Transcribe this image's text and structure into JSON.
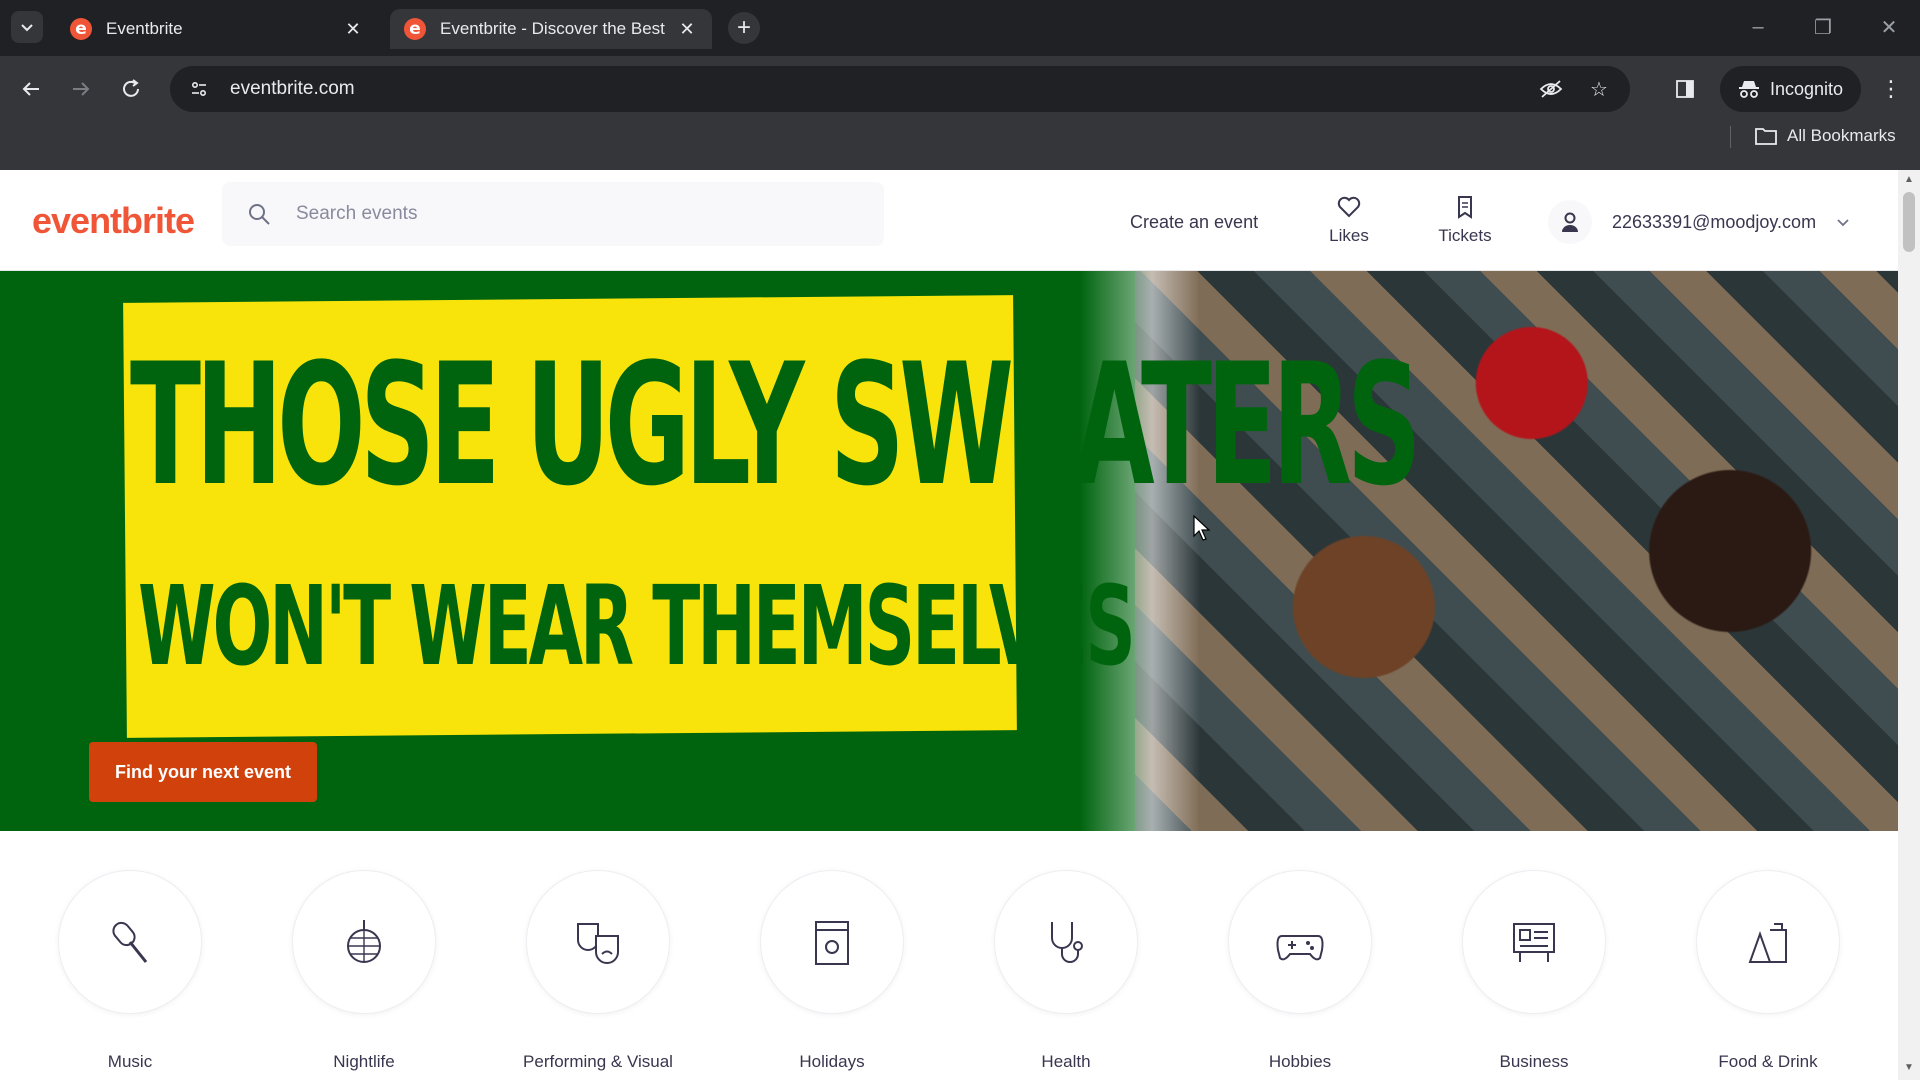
{
  "browser": {
    "tabs": [
      {
        "title": "Eventbrite",
        "favicon": "e",
        "active": false
      },
      {
        "title": "Eventbrite - Discover the Best",
        "favicon": "e",
        "active": true
      }
    ],
    "url": "eventbrite.com",
    "incognito_label": "Incognito",
    "bookmarks_label": "All Bookmarks"
  },
  "header": {
    "logo": "eventbrite",
    "search_placeholder": "Search events",
    "create_event": "Create an event",
    "likes": "Likes",
    "tickets": "Tickets",
    "account_email": "22633391@moodjoy.com"
  },
  "hero": {
    "headline_line1": "THOSE UGLY SWEATERS",
    "headline_line2": "WON'T WEAR THEMSELVES",
    "cta": "Find your next event"
  },
  "categories": [
    {
      "label": "Music",
      "icon": "microphone-icon"
    },
    {
      "label": "Nightlife",
      "icon": "disco-ball-icon"
    },
    {
      "label": "Performing & Visual",
      "icon": "theater-masks-icon"
    },
    {
      "label": "Holidays",
      "icon": "calendar-sun-icon"
    },
    {
      "label": "Health",
      "icon": "stethoscope-icon"
    },
    {
      "label": "Hobbies",
      "icon": "gamepad-icon"
    },
    {
      "label": "Business",
      "icon": "presentation-board-icon"
    },
    {
      "label": "Food & Drink",
      "icon": "food-drink-icon"
    }
  ],
  "colors": {
    "brand": "#f05537",
    "hero_green": "#00640f",
    "hero_yellow": "#f8e40a",
    "cta": "#d1410c"
  }
}
